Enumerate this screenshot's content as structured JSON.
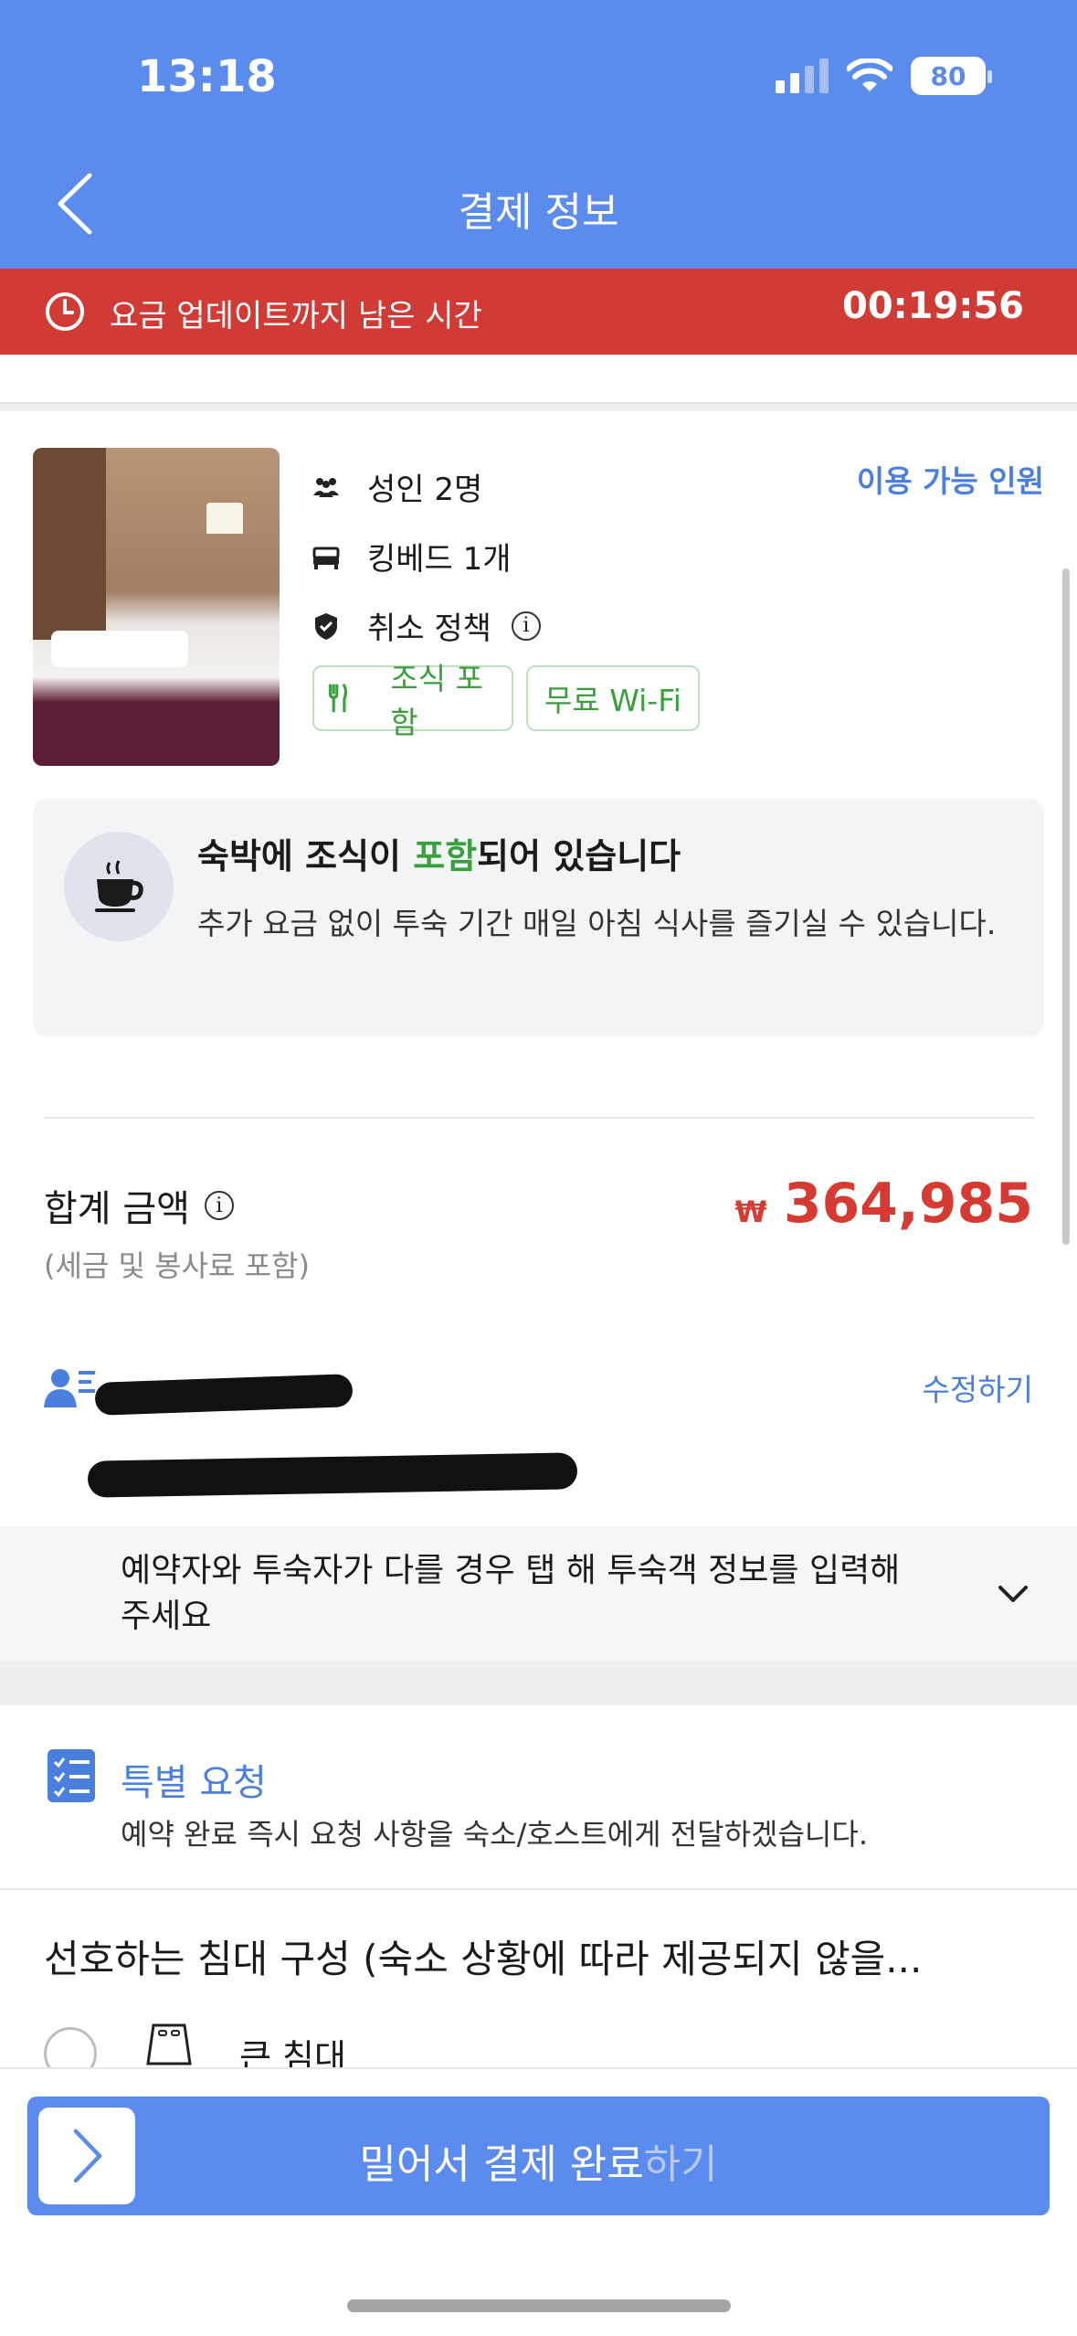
{
  "status_bar": {
    "time": "13:18",
    "battery": "80"
  },
  "nav": {
    "title": "결제 정보"
  },
  "timer": {
    "label": "요금 업데이트까지 남은 시간",
    "value": "00:19:56"
  },
  "room": {
    "occupancy": "성인 2명",
    "bed": "킹베드 1개",
    "cancellation": "취소 정책",
    "available_link": "이용 가능 인원",
    "tags": [
      "조식 포함",
      "무료 Wi-Fi"
    ]
  },
  "breakfast_notice": {
    "title_prefix": "숙박에 조식이 ",
    "title_highlight": "포함",
    "title_suffix": "되어 있습니다",
    "description": "추가 요금 없이 투숙 기간 매일 아침 식사를 즐기실 수 있습니다."
  },
  "total": {
    "label": "합계 금액",
    "sub": "(세금 및 봉사료 포함)",
    "currency": "₩",
    "amount": "364,985"
  },
  "booker": {
    "edit_label": "수정하기"
  },
  "guest_toggle": {
    "text": "예약자와 투숙자가 다를 경우 탭 해 투숙객 정보를 입력해 주세요"
  },
  "special_request": {
    "title": "특별 요청",
    "description": "예약 완료 즉시 요청 사항을 숙소/호스트에게 전달하겠습니다."
  },
  "bed_preference": {
    "title": "선호하는 침대 구성 (숙소 상황에 따라 제공되지 않을...",
    "options": [
      "큰 침대"
    ]
  },
  "pay_slider": {
    "label_main": "밀어서 결제 완료",
    "label_fade": "하기"
  },
  "colors": {
    "brand": "#5b8bed",
    "alert": "#d13b35",
    "price": "#d53a33",
    "green": "#38a13c",
    "link": "#4a7fe0"
  }
}
